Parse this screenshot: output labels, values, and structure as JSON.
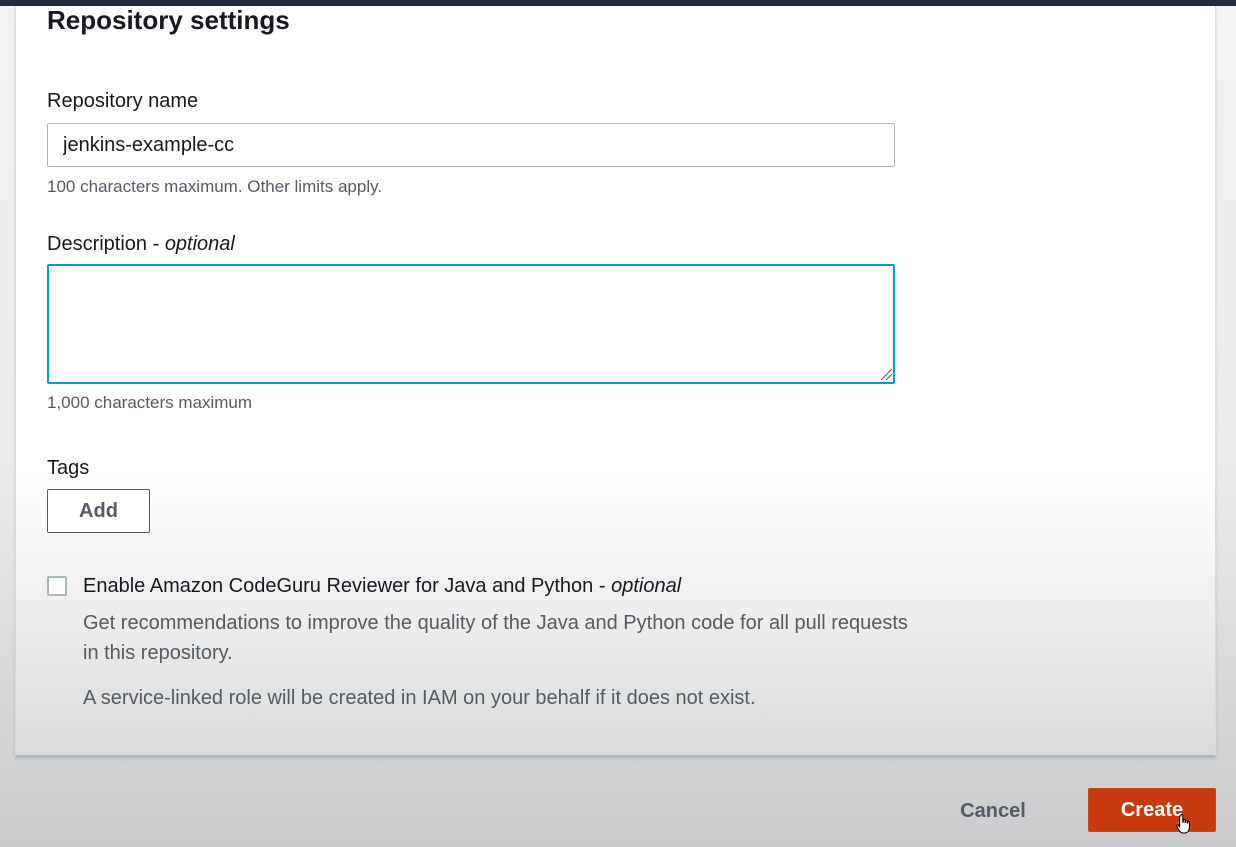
{
  "section": {
    "title": "Repository settings"
  },
  "repository_name": {
    "label": "Repository name",
    "value": "jenkins-example-cc",
    "hint": "100 characters maximum. Other limits apply."
  },
  "description": {
    "label": "Description - ",
    "label_suffix": "optional",
    "value": "",
    "hint": "1,000 characters maximum"
  },
  "tags": {
    "label": "Tags",
    "add_label": "Add"
  },
  "codeguru": {
    "checked": false,
    "label": "Enable Amazon CodeGuru Reviewer for Java and Python - ",
    "label_suffix": "optional",
    "description": "Get recommendations to improve the quality of the Java and Python code for all pull requests in this repository.",
    "note": "A service-linked role will be created in IAM on your behalf if it does not exist."
  },
  "actions": {
    "cancel_label": "Cancel",
    "create_label": "Create"
  },
  "colors": {
    "primary_button": "#c7390f",
    "focus_ring": "#00a1c9",
    "text": "#16191f",
    "secondary_text": "#545b64"
  },
  "icons": {
    "cursor": "hand-pointer-icon",
    "resize": "resize-grip-icon"
  }
}
